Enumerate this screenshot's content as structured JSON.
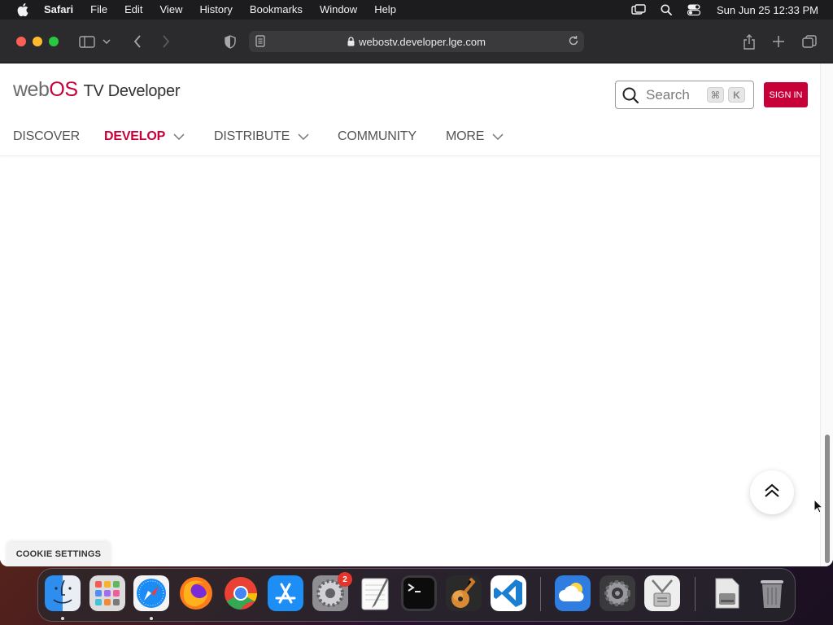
{
  "menubar": {
    "app_name": "Safari",
    "menus": [
      "File",
      "Edit",
      "View",
      "History",
      "Bookmarks",
      "Window",
      "Help"
    ],
    "clock": "Sun Jun 25  12:33 PM"
  },
  "browser": {
    "url": "webostv.developer.lge.com"
  },
  "site": {
    "logo_web": "web",
    "logo_os": "OS",
    "logo_tv": "TV Developer",
    "search_placeholder": "Search",
    "search_shortcut_cmd": "⌘",
    "search_shortcut_key": "K",
    "signin_label": "SIGN IN",
    "nav": {
      "discover": "DISCOVER",
      "develop": "DEVELOP",
      "distribute": "DISTRIBUTE",
      "community": "COMMUNITY",
      "more": "MORE"
    },
    "cookie_label": "COOKIE SETTINGS"
  },
  "dock": {
    "apps": [
      "Finder",
      "Launchpad",
      "Safari",
      "Firefox",
      "Chrome",
      "App Store",
      "System Preferences",
      "TextEdit",
      "Terminal",
      "GarageBand",
      "Visual Studio Code",
      "Weather",
      "Settings",
      "Archive Utility",
      "Disk Image",
      "Trash"
    ],
    "system_preferences_badge": "2"
  },
  "colors": {
    "brand": "#c7003a",
    "menubar_bg": "#1c1c1e",
    "toolbar_bg": "#2b2b2d"
  }
}
